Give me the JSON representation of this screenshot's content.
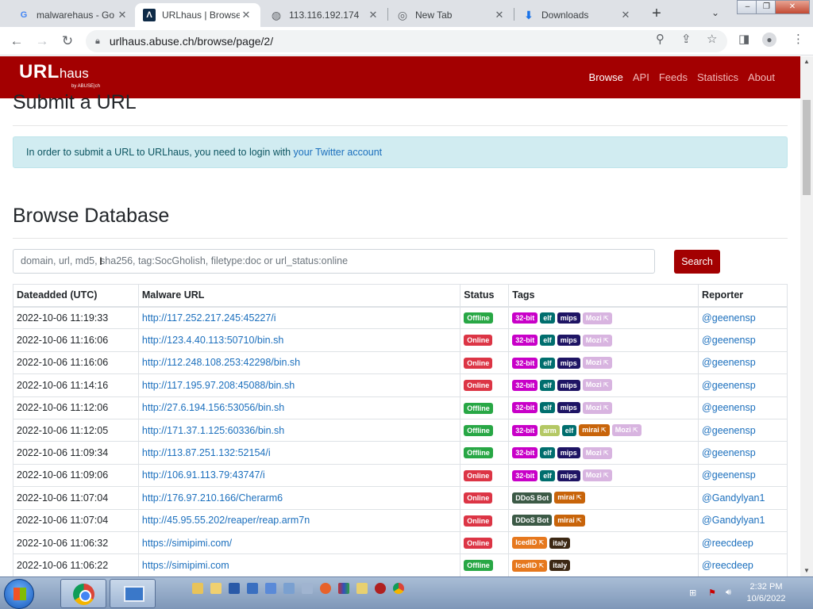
{
  "browser": {
    "tabs": [
      {
        "title": "malwarehaus - Go",
        "icon": "google-icon",
        "active": false
      },
      {
        "title": "URLhaus | Browse",
        "icon": "urlhaus-icon",
        "active": true
      },
      {
        "title": "113.116.192.174",
        "icon": "globe-icon",
        "active": false
      },
      {
        "title": "New Tab",
        "icon": "chrome-icon",
        "active": false
      },
      {
        "title": "Downloads",
        "icon": "download-icon",
        "active": false
      }
    ],
    "address": "urlhaus.abuse.ch/browse/page/2/"
  },
  "site": {
    "brand_main": "URL",
    "brand_sub": "haus",
    "brand_by": "by ABUSE|ch",
    "nav": [
      "Browse",
      "API",
      "Feeds",
      "Statistics",
      "About"
    ],
    "active_nav": "Browse",
    "accent": "#a30001"
  },
  "submit": {
    "heading": "Submit a URL",
    "notice_prefix": "In order to submit a URL to URLhaus, you need to login with ",
    "notice_link": "your Twitter account"
  },
  "browse": {
    "heading": "Browse Database",
    "search_placeholder": "domain, url, md5, sha256, tag:SocGholish, filetype:doc or url_status:online",
    "search_button": "Search"
  },
  "table": {
    "columns": [
      "Dateadded (UTC)",
      "Malware URL",
      "Status",
      "Tags",
      "Reporter"
    ],
    "rows": [
      {
        "date": "2022-10-06 11:19:33",
        "url": "http://117.252.217.245:45227/i",
        "status": "Offline",
        "tags": [
          {
            "t": "32-bit",
            "c": "#c800c8"
          },
          {
            "t": "elf",
            "c": "#006e6e"
          },
          {
            "t": "mips",
            "c": "#1e1464"
          },
          {
            "t": "Mozi",
            "c": "#d8b4e0",
            "link": true
          }
        ],
        "reporter": "@geenensp"
      },
      {
        "date": "2022-10-06 11:16:06",
        "url": "http://123.4.40.113:50710/bin.sh",
        "status": "Online",
        "tags": [
          {
            "t": "32-bit",
            "c": "#c800c8"
          },
          {
            "t": "elf",
            "c": "#006e6e"
          },
          {
            "t": "mips",
            "c": "#1e1464"
          },
          {
            "t": "Mozi",
            "c": "#d8b4e0",
            "link": true
          }
        ],
        "reporter": "@geenensp"
      },
      {
        "date": "2022-10-06 11:16:06",
        "url": "http://112.248.108.253:42298/bin.sh",
        "status": "Online",
        "tags": [
          {
            "t": "32-bit",
            "c": "#c800c8"
          },
          {
            "t": "elf",
            "c": "#006e6e"
          },
          {
            "t": "mips",
            "c": "#1e1464"
          },
          {
            "t": "Mozi",
            "c": "#d8b4e0",
            "link": true
          }
        ],
        "reporter": "@geenensp"
      },
      {
        "date": "2022-10-06 11:14:16",
        "url": "http://117.195.97.208:45088/bin.sh",
        "status": "Online",
        "tags": [
          {
            "t": "32-bit",
            "c": "#c800c8"
          },
          {
            "t": "elf",
            "c": "#006e6e"
          },
          {
            "t": "mips",
            "c": "#1e1464"
          },
          {
            "t": "Mozi",
            "c": "#d8b4e0",
            "link": true
          }
        ],
        "reporter": "@geenensp"
      },
      {
        "date": "2022-10-06 11:12:06",
        "url": "http://27.6.194.156:53056/bin.sh",
        "status": "Offline",
        "tags": [
          {
            "t": "32-bit",
            "c": "#c800c8"
          },
          {
            "t": "elf",
            "c": "#006e6e"
          },
          {
            "t": "mips",
            "c": "#1e1464"
          },
          {
            "t": "Mozi",
            "c": "#d8b4e0",
            "link": true
          }
        ],
        "reporter": "@geenensp"
      },
      {
        "date": "2022-10-06 11:12:05",
        "url": "http://171.37.1.125:60336/bin.sh",
        "status": "Offline",
        "tags": [
          {
            "t": "32-bit",
            "c": "#c800c8"
          },
          {
            "t": "arm",
            "c": "#b4c864"
          },
          {
            "t": "elf",
            "c": "#006e6e"
          },
          {
            "t": "mirai",
            "c": "#c8640a",
            "link": true
          },
          {
            "t": "Mozi",
            "c": "#d8b4e0",
            "link": true
          }
        ],
        "reporter": "@geenensp"
      },
      {
        "date": "2022-10-06 11:09:34",
        "url": "http://113.87.251.132:52154/i",
        "status": "Offline",
        "tags": [
          {
            "t": "32-bit",
            "c": "#c800c8"
          },
          {
            "t": "elf",
            "c": "#006e6e"
          },
          {
            "t": "mips",
            "c": "#1e1464"
          },
          {
            "t": "Mozi",
            "c": "#d8b4e0",
            "link": true
          }
        ],
        "reporter": "@geenensp"
      },
      {
        "date": "2022-10-06 11:09:06",
        "url": "http://106.91.113.79:43747/i",
        "status": "Online",
        "tags": [
          {
            "t": "32-bit",
            "c": "#c800c8"
          },
          {
            "t": "elf",
            "c": "#006e6e"
          },
          {
            "t": "mips",
            "c": "#1e1464"
          },
          {
            "t": "Mozi",
            "c": "#d8b4e0",
            "link": true
          }
        ],
        "reporter": "@geenensp"
      },
      {
        "date": "2022-10-06 11:07:04",
        "url": "http://176.97.210.166/Cherarm6",
        "status": "Online",
        "tags": [
          {
            "t": "DDoS Bot",
            "c": "#3c5a46"
          },
          {
            "t": "mirai",
            "c": "#c8640a",
            "link": true
          }
        ],
        "reporter": "@Gandylyan1"
      },
      {
        "date": "2022-10-06 11:07:04",
        "url": "http://45.95.55.202/reaper/reap.arm7n",
        "status": "Online",
        "tags": [
          {
            "t": "DDoS Bot",
            "c": "#3c5a46"
          },
          {
            "t": "mirai",
            "c": "#c8640a",
            "link": true
          }
        ],
        "reporter": "@Gandylyan1"
      },
      {
        "date": "2022-10-06 11:06:32",
        "url": "https://simipimi.com/",
        "status": "Online",
        "tags": [
          {
            "t": "IcedID",
            "c": "#e6781e",
            "link": true
          },
          {
            "t": "italy",
            "c": "#3c2814"
          }
        ],
        "reporter": "@reecdeep"
      },
      {
        "date": "2022-10-06 11:06:22",
        "url": "https://simipimi.com",
        "status": "Offline",
        "tags": [
          {
            "t": "IcedID",
            "c": "#e6781e",
            "link": true
          },
          {
            "t": "italy",
            "c": "#3c2814"
          }
        ],
        "reporter": "@reecdeep"
      }
    ]
  },
  "taskbar": {
    "time": "2:32 PM",
    "date": "10/6/2022"
  }
}
